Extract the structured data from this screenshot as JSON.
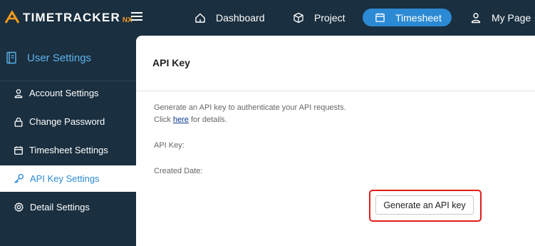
{
  "app": {
    "logo_text": "TIMETRACKER",
    "logo_suffix": "NX"
  },
  "nav": {
    "items": [
      {
        "label": "Dashboard",
        "icon": "home-icon"
      },
      {
        "label": "Project",
        "icon": "cube-icon"
      },
      {
        "label": "Timesheet",
        "icon": "calendar-icon",
        "active": true
      },
      {
        "label": "My Page",
        "icon": "user-icon"
      }
    ]
  },
  "sidebar": {
    "title": "User Settings",
    "items": [
      {
        "label": "Account Settings",
        "icon": "user-icon"
      },
      {
        "label": "Change Password",
        "icon": "lock-icon"
      },
      {
        "label": "Timesheet Settings",
        "icon": "calendar-icon"
      },
      {
        "label": "API Key Settings",
        "icon": "key-icon",
        "active": true
      },
      {
        "label": "Detail Settings",
        "icon": "gear-icon"
      }
    ]
  },
  "main": {
    "title": "API Key",
    "description_line1": "Generate an API key to authenticate your API requests.",
    "description_prefix": "Click ",
    "description_link": "here",
    "description_suffix": " for details.",
    "api_key_label": "API Key:",
    "created_date_label": "Created Date:",
    "generate_button": "Generate an API key"
  },
  "colors": {
    "dark_bg": "#1a2f3f",
    "accent": "#2c8ad4",
    "logo_orange": "#f39a1d",
    "highlight_red": "#e21c1c"
  }
}
